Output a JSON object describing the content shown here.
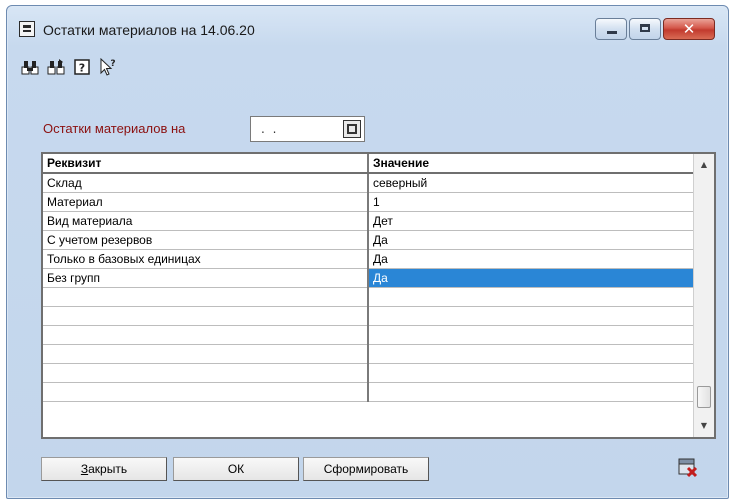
{
  "window": {
    "title": "Остатки материалов на 14.06.20",
    "app_icon": "report-icon",
    "controls": [
      "minimize-icon",
      "maximize-icon",
      "close-icon"
    ]
  },
  "toolbar": {
    "icons": [
      "find-icon",
      "find-next-icon",
      "help-icon",
      "context-help-icon"
    ]
  },
  "param": {
    "label": "Остатки материалов на",
    "date_value": ". .",
    "calendar_icon": "calendar-button-icon"
  },
  "grid": {
    "headers": [
      "Реквизит",
      "Значение"
    ],
    "rows": [
      {
        "name": "Склад",
        "value": "северный"
      },
      {
        "name": "Материал",
        "value": "1"
      },
      {
        "name": "Вид материала",
        "value": "Дет"
      },
      {
        "name": "С учетом резервов",
        "value": "Да"
      },
      {
        "name": "Только в базовых единицах",
        "value": "Да"
      },
      {
        "name": "Без групп",
        "value": "Да"
      },
      {
        "name": "",
        "value": ""
      },
      {
        "name": "",
        "value": ""
      },
      {
        "name": "",
        "value": ""
      },
      {
        "name": "",
        "value": ""
      },
      {
        "name": "",
        "value": ""
      },
      {
        "name": "",
        "value": ""
      }
    ],
    "selected_row": 5,
    "colors": {
      "selection": "#2a86d6",
      "param_label": "#8b1010"
    }
  },
  "buttons": {
    "close_label": "Закрыть",
    "ok_label": "ОК",
    "build_label": "Сформировать",
    "exit_icon": "exit-icon"
  }
}
